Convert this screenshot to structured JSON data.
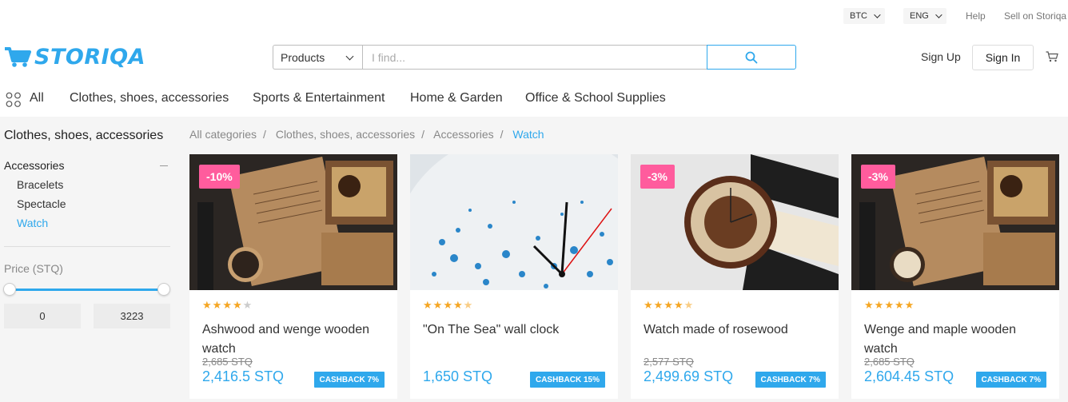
{
  "topbar": {
    "currency": "BTC",
    "language": "ENG",
    "help": "Help",
    "sell": "Sell on Storiqa"
  },
  "header": {
    "logo": "STORIQA",
    "search_category": "Products",
    "search_placeholder": "I find...",
    "sign_up": "Sign Up",
    "sign_in": "Sign In"
  },
  "categories": [
    "All",
    "Clothes, shoes, accessories",
    "Sports & Entertainment",
    "Home & Garden",
    "Office & School Supplies"
  ],
  "sidebar": {
    "title": "Clothes, shoes, accessories",
    "group": "Accessories",
    "items": [
      "Bracelets",
      "Spectacle",
      "Watch"
    ],
    "active_item": "Watch",
    "price_label": "Price (STQ)",
    "price_min": "0",
    "price_max": "3223"
  },
  "breadcrumbs": [
    "All categories",
    "Clothes, shoes, accessories",
    "Accessories",
    "Watch"
  ],
  "colors": {
    "accent": "#2fa8ec",
    "discount": "#ff5c9d",
    "star": "#f5a623"
  },
  "products": [
    {
      "name": "Ashwood and wenge wooden watch",
      "discount": "-10%",
      "rating": 4,
      "old_price": "2,685 STQ",
      "price": "2,416.5 STQ",
      "cashback": "CASHBACK 7%"
    },
    {
      "name": "\"On The Sea\" wall clock",
      "discount": "",
      "rating": 4.5,
      "old_price": "",
      "price": "1,650 STQ",
      "cashback": "CASHBACK 15%"
    },
    {
      "name": "Watch made of rosewood",
      "discount": "-3%",
      "rating": 4.5,
      "old_price": "2,577 STQ",
      "price": "2,499.69 STQ",
      "cashback": "CASHBACK 7%"
    },
    {
      "name": "Wenge and maple wooden watch",
      "discount": "-3%",
      "rating": 5,
      "old_price": "2,685 STQ",
      "price": "2,604.45 STQ",
      "cashback": "CASHBACK 7%"
    }
  ]
}
